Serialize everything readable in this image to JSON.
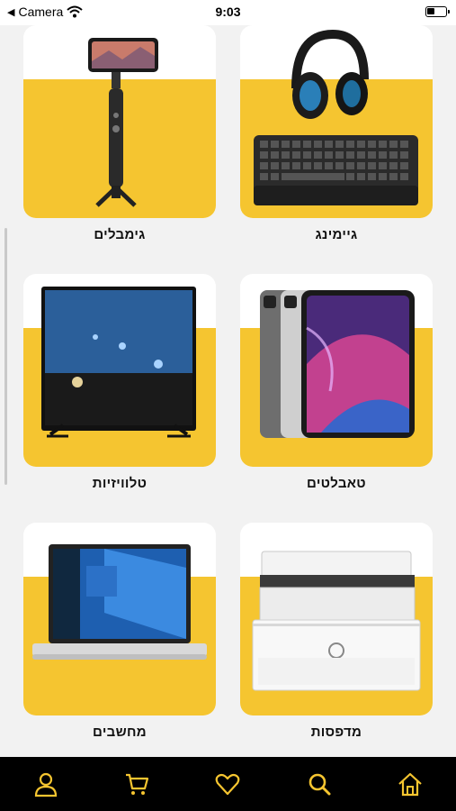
{
  "status_bar": {
    "back_label": "Camera",
    "time": "9:03"
  },
  "categories": [
    {
      "label": "גיימינג",
      "icon": "gaming-keyboard-headset-image"
    },
    {
      "label": "גימבלים",
      "icon": "gimbal-image"
    },
    {
      "label": "טאבלטים",
      "icon": "tablet-image"
    },
    {
      "label": "טלוויזיות",
      "icon": "tv-image"
    },
    {
      "label": "מדפסות",
      "icon": "printer-image"
    },
    {
      "label": "מחשבים",
      "icon": "laptop-image"
    }
  ],
  "tab_bar": {
    "items": [
      "home-icon",
      "search-icon",
      "heart-icon",
      "cart-icon",
      "user-icon"
    ]
  },
  "colors": {
    "accent": "#f5c530",
    "tab_bar_bg": "#000000"
  }
}
